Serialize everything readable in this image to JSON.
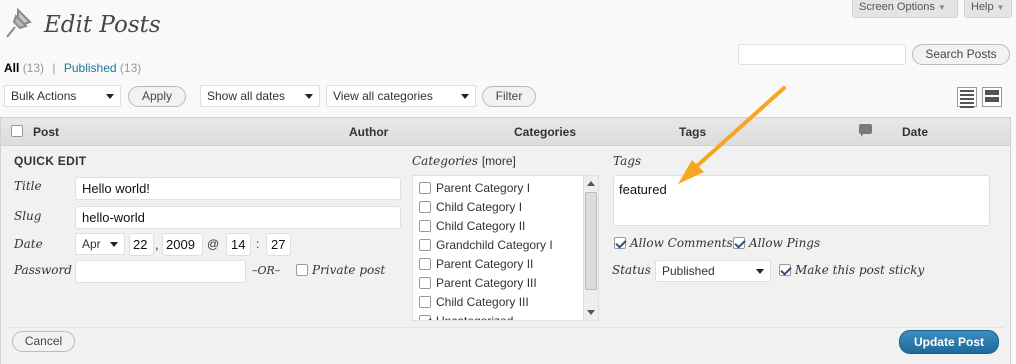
{
  "header": {
    "title": "Edit Posts",
    "screen_options": "Screen Options",
    "help": "Help",
    "search_button": "Search Posts",
    "search_value": ""
  },
  "filters": {
    "all": "All",
    "all_count": "(13)",
    "separator": "|",
    "published": "Published",
    "published_count": "(13)"
  },
  "actions": {
    "bulk": "Bulk Actions",
    "apply": "Apply",
    "dates": "Show all dates",
    "categories": "View all categories",
    "filter": "Filter"
  },
  "columns": {
    "post": "Post",
    "author": "Author",
    "categories": "Categories",
    "tags": "Tags",
    "date": "Date"
  },
  "quick_edit": {
    "heading": "QUICK EDIT",
    "title_label": "Title",
    "title_value": "Hello world!",
    "slug_label": "Slug",
    "slug_value": "hello-world",
    "date_label": "Date",
    "month": "Apr",
    "day": "22",
    "comma": ",",
    "year": "2009",
    "at": "@",
    "hour": "14",
    "colon": ":",
    "minute": "27",
    "password_label": "Password",
    "password_value": "",
    "or_text": "–OR–",
    "private_label": "Private post",
    "categories_label": "Categories",
    "categories_more": "[more]",
    "categories": [
      {
        "label": "Parent Category I",
        "checked": false
      },
      {
        "label": "Child Category I",
        "checked": false
      },
      {
        "label": "Child Category II",
        "checked": false
      },
      {
        "label": "Grandchild Category I",
        "checked": false
      },
      {
        "label": "Parent Category II",
        "checked": false
      },
      {
        "label": "Parent Category III",
        "checked": false
      },
      {
        "label": "Child Category III",
        "checked": false
      },
      {
        "label": "Uncategorized",
        "checked": true
      }
    ],
    "tags_label": "Tags",
    "tags_value": "featured",
    "allow_comments": "Allow Comments",
    "allow_pings": "Allow Pings",
    "status_label": "Status",
    "status_value": "Published",
    "sticky_label": "Make this post sticky",
    "cancel": "Cancel",
    "update": "Update Post"
  },
  "annotation": {
    "arrow_color": "#f5a623"
  },
  "colors": {
    "link": "#21759b",
    "primary": "#21759b"
  }
}
